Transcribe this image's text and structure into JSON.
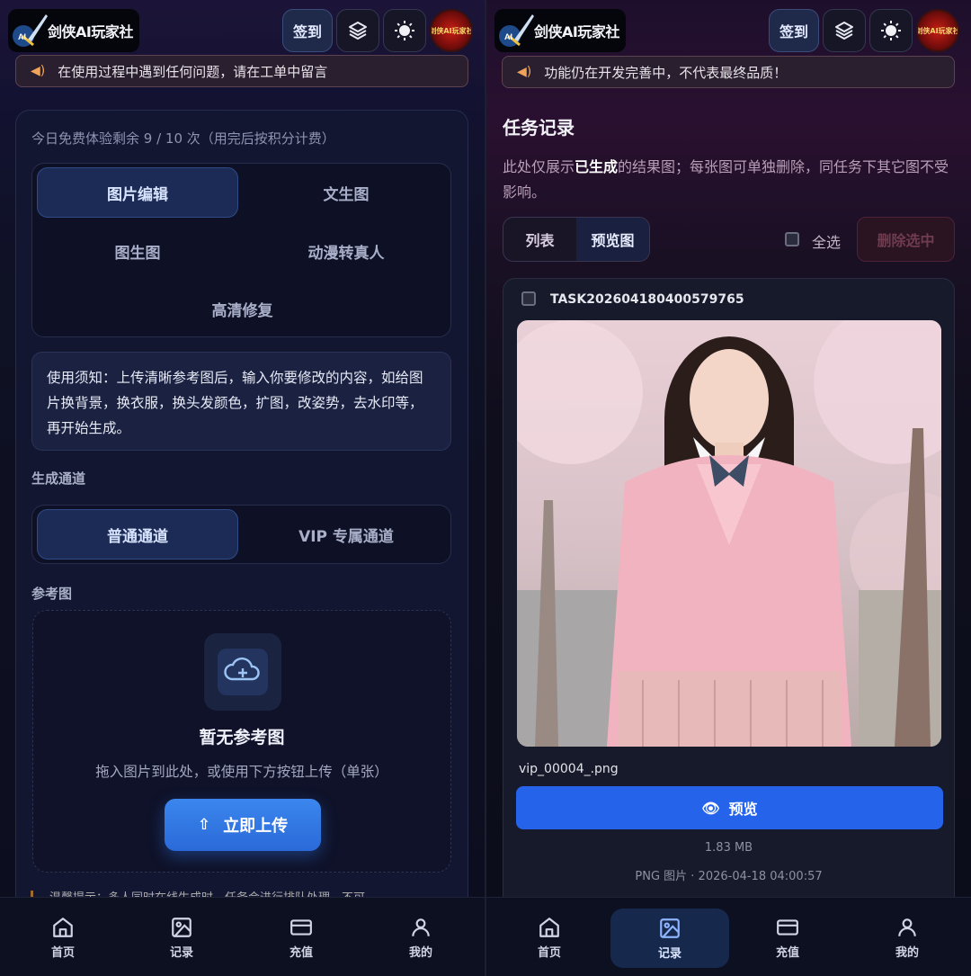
{
  "app": {
    "logo_text": "剑侠AI玩家社",
    "sign_in": "签到",
    "avatar_text": "剑侠AI玩家社"
  },
  "left": {
    "notice": "在使用过程中遇到任何问题，请在工单中留言",
    "quota": "今日免费体验剩余 9 / 10 次（用完后按积分计费）",
    "tabs": [
      "图片编辑",
      "文生图",
      "图生图",
      "动漫转真人",
      "高清修复"
    ],
    "active_tab": "图片编辑",
    "tips": "使用须知：上传清晰参考图后，输入你要修改的内容，如给图片换背景，换衣服，换头发颜色，扩图，改姿势，去水印等，再开始生成。",
    "channel_label": "生成通道",
    "channels": [
      "普通通道",
      "VIP 专属通道"
    ],
    "active_channel": "普通通道",
    "ref_label": "参考图",
    "upload_title": "暂无参考图",
    "upload_desc": "拖入图片到此处，或使用下方按钮上传（单张）",
    "upload_button": "立即上传",
    "peek_text": "温馨提示：多人同时在线生成时，任务会进行排队处理，不可"
  },
  "right": {
    "notice": "功能仍在开发完善中，不代表最终品质！",
    "title": "任务记录",
    "desc_before": "此处仅展示",
    "desc_bold": "已生成",
    "desc_after": "的结果图；每张图可单独删除，同任务下其它图不受影响。",
    "view_list": "列表",
    "view_preview": "预览图",
    "select_all": "全选",
    "delete_selected": "删除选中",
    "task": {
      "id": "TASK202604180400579765",
      "filename": "vip_00004_.png",
      "preview_button": "预览",
      "size": "1.83 MB",
      "meta": "PNG 图片 · 2026-04-18 04:00:57"
    }
  },
  "nav": {
    "items": [
      "首页",
      "记录",
      "充值",
      "我的"
    ],
    "left_active": null,
    "right_active": "记录"
  },
  "colors": {
    "accent": "#2563eb",
    "notice_icon": "#f0a45a",
    "active_tab_bg": "#1c2b55"
  }
}
